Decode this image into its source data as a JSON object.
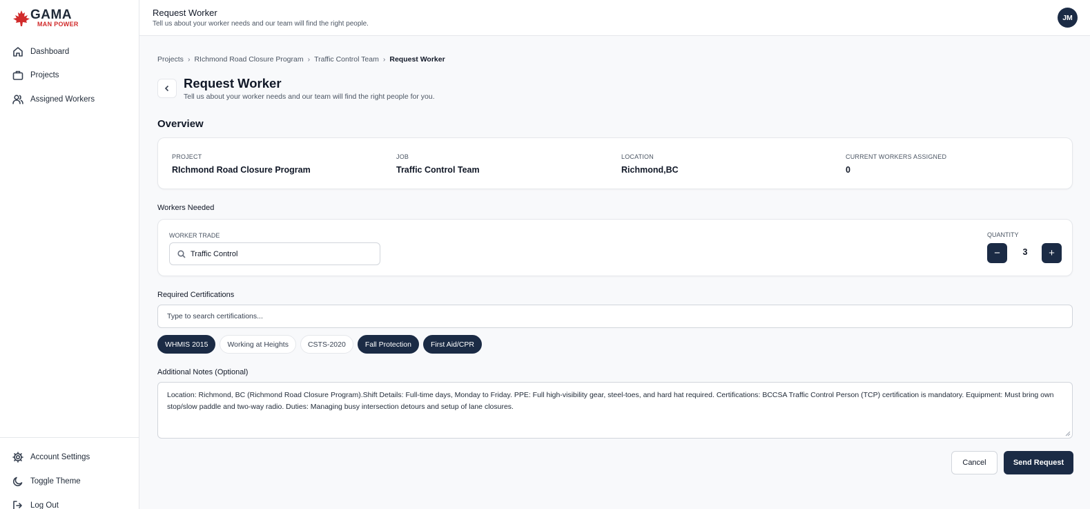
{
  "brand": {
    "name": "GAMA",
    "sub": "MAN POWER",
    "accent_red": "#d12b2b",
    "navy": "#1b2b45"
  },
  "sidebar": {
    "items": [
      {
        "label": "Dashboard",
        "icon": "home-icon"
      },
      {
        "label": "Projects",
        "icon": "briefcase-icon"
      },
      {
        "label": "Assigned Workers",
        "icon": "users-icon"
      }
    ],
    "bottom_items": [
      {
        "label": "Account Settings",
        "icon": "gear-icon"
      },
      {
        "label": "Toggle Theme",
        "icon": "moon-icon"
      },
      {
        "label": "Log Out",
        "icon": "logout-icon"
      }
    ]
  },
  "header": {
    "title": "Request Worker",
    "subtitle": "Tell us about your worker needs and our team will find the right people.",
    "avatar_initials": "JM"
  },
  "breadcrumb": {
    "items": [
      "Projects",
      "RIchmond Road Closure Program",
      "Traffic Control Team"
    ],
    "current": "Request Worker"
  },
  "page": {
    "title": "Request Worker",
    "subtitle": "Tell us about your worker needs and our team will find the right people for you."
  },
  "overview": {
    "title": "Overview",
    "fields": [
      {
        "label": "PROJECT",
        "value": "RIchmond Road Closure Program"
      },
      {
        "label": "JOB",
        "value": "Traffic Control Team"
      },
      {
        "label": "LOCATION",
        "value": "Richmond,BC"
      },
      {
        "label": "CURRENT WORKERS ASSIGNED",
        "value": "0"
      }
    ]
  },
  "workers_needed": {
    "title": "Workers Needed",
    "trade_label": "WORKER TRADE",
    "trade_value": "Traffic Control",
    "quantity_label": "QUANTITY",
    "quantity": "3",
    "minus": "−",
    "plus": "+"
  },
  "certifications": {
    "title": "Required Certifications",
    "placeholder": "Type to search certifications...",
    "chips": [
      {
        "label": "WHMIS 2015",
        "selected": true
      },
      {
        "label": "Working at Heights",
        "selected": false
      },
      {
        "label": "CSTS-2020",
        "selected": false
      },
      {
        "label": "Fall Protection",
        "selected": true
      },
      {
        "label": "First Aid/CPR",
        "selected": true
      }
    ]
  },
  "notes": {
    "title": "Additional Notes (Optional)",
    "value": "Location: Richmond, BC (Richmond Road Closure Program).Shift Details: Full-time days, Monday to Friday. PPE: Full high-visibility gear, steel-toes, and hard hat required. Certifications: BCCSA Traffic Control Person (TCP) certification is mandatory. Equipment: Must bring own stop/slow paddle and two-way radio. Duties: Managing busy intersection detours and setup of lane closures."
  },
  "actions": {
    "cancel": "Cancel",
    "send": "Send Request"
  }
}
